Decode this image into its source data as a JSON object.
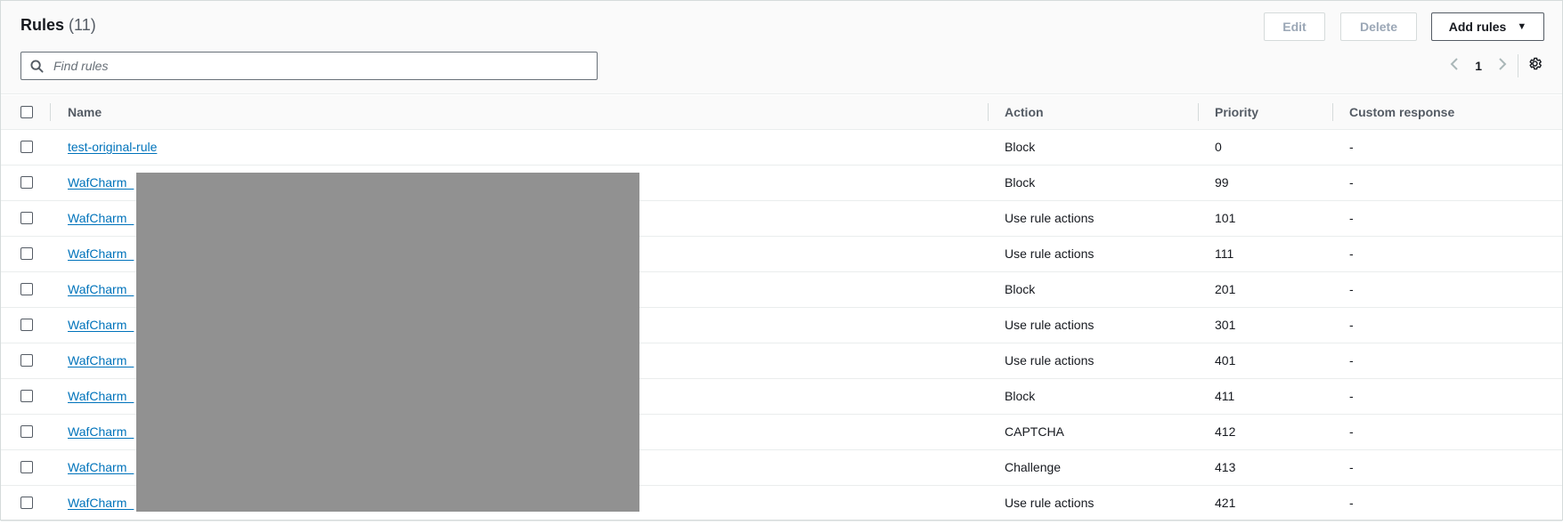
{
  "header": {
    "title": "Rules",
    "count": "(11)",
    "buttons": {
      "edit": "Edit",
      "delete": "Delete",
      "add_rules": "Add rules"
    },
    "search": {
      "placeholder": "Find rules",
      "value": ""
    },
    "pagination": {
      "page": "1"
    }
  },
  "table": {
    "columns": {
      "name": "Name",
      "action": "Action",
      "priority": "Priority",
      "custom_response": "Custom response"
    },
    "rows": [
      {
        "name": "test-original-rule",
        "action": "Block",
        "priority": "0",
        "custom_response": "-"
      },
      {
        "name": "WafCharm_",
        "action": "Block",
        "priority": "99",
        "custom_response": "-"
      },
      {
        "name": "WafCharm_",
        "action": "Use rule actions",
        "priority": "101",
        "custom_response": "-"
      },
      {
        "name": "WafCharm_",
        "action": "Use rule actions",
        "priority": "111",
        "custom_response": "-"
      },
      {
        "name": "WafCharm_",
        "action": "Block",
        "priority": "201",
        "custom_response": "-"
      },
      {
        "name": "WafCharm_",
        "action": "Use rule actions",
        "priority": "301",
        "custom_response": "-"
      },
      {
        "name": "WafCharm_",
        "action": "Use rule actions",
        "priority": "401",
        "custom_response": "-"
      },
      {
        "name": "WafCharm_",
        "action": "Block",
        "priority": "411",
        "custom_response": "-"
      },
      {
        "name": "WafCharm_",
        "action": "CAPTCHA",
        "priority": "412",
        "custom_response": "-"
      },
      {
        "name": "WafCharm_",
        "action": "Challenge",
        "priority": "413",
        "custom_response": "-"
      },
      {
        "name": "WafCharm_",
        "action": "Use rule actions",
        "priority": "421",
        "custom_response": "-"
      }
    ]
  },
  "colors": {
    "link": "#0073bb",
    "redaction": "#919191",
    "border": "#eaeded"
  }
}
